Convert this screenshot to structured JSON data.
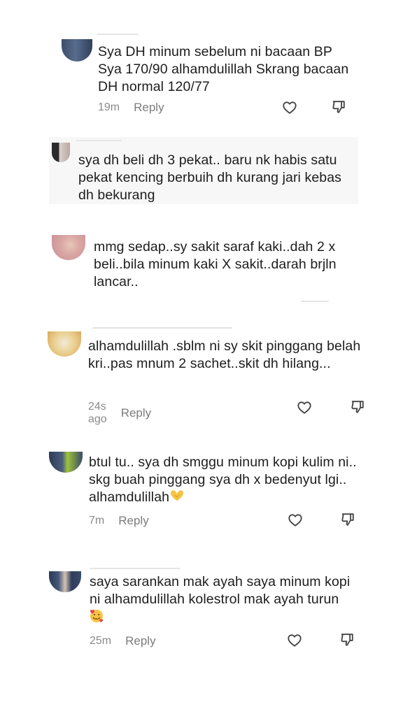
{
  "comments": [
    {
      "text": "Sya DH minum sebelum ni bacaan BP Sya 170/90 alhamdulillah Skrang bacaan DH normal 120/77",
      "time": "19m",
      "reply": "Reply"
    },
    {
      "text": "sya dh beli dh 3 pekat.. baru nk habis satu pekat kencing berbuih dh kurang jari kebas dh bekurang"
    },
    {
      "text": "mmg sedap..sy sakit saraf kaki..dah 2 x beli..bila minum kaki X sakit..darah brjln lancar.."
    },
    {
      "text": "alhamdulillah .sblm ni sy skit pinggang belah kri..pas mnum 2 sachet..skit dh hilang...",
      "time": "24s ago",
      "reply": "Reply"
    },
    {
      "text": "btul tu.. sya dh smggu minum kopi kulim ni.. skg buah pinggang sya dh x bedenyut lgi.. alhamdulillah",
      "time": "7m",
      "reply": "Reply"
    },
    {
      "text": "saya sarankan mak ayah saya minum kopi ni alhamdulillah kolestrol mak ayah turun",
      "time": "25m",
      "reply": "Reply"
    }
  ],
  "icons": {
    "like": "heart-outline-icon",
    "dislike": "thumbs-down-icon",
    "emoji_heart_hands": "heart-hands-emoji",
    "emoji_smiling_hearts": "smiling-face-with-hearts-emoji"
  },
  "colors": {
    "text": "#1d1d1d",
    "meta": "#8a8a8a",
    "emoji_yellow": "#f6c344",
    "emoji_red": "#e8403a"
  }
}
